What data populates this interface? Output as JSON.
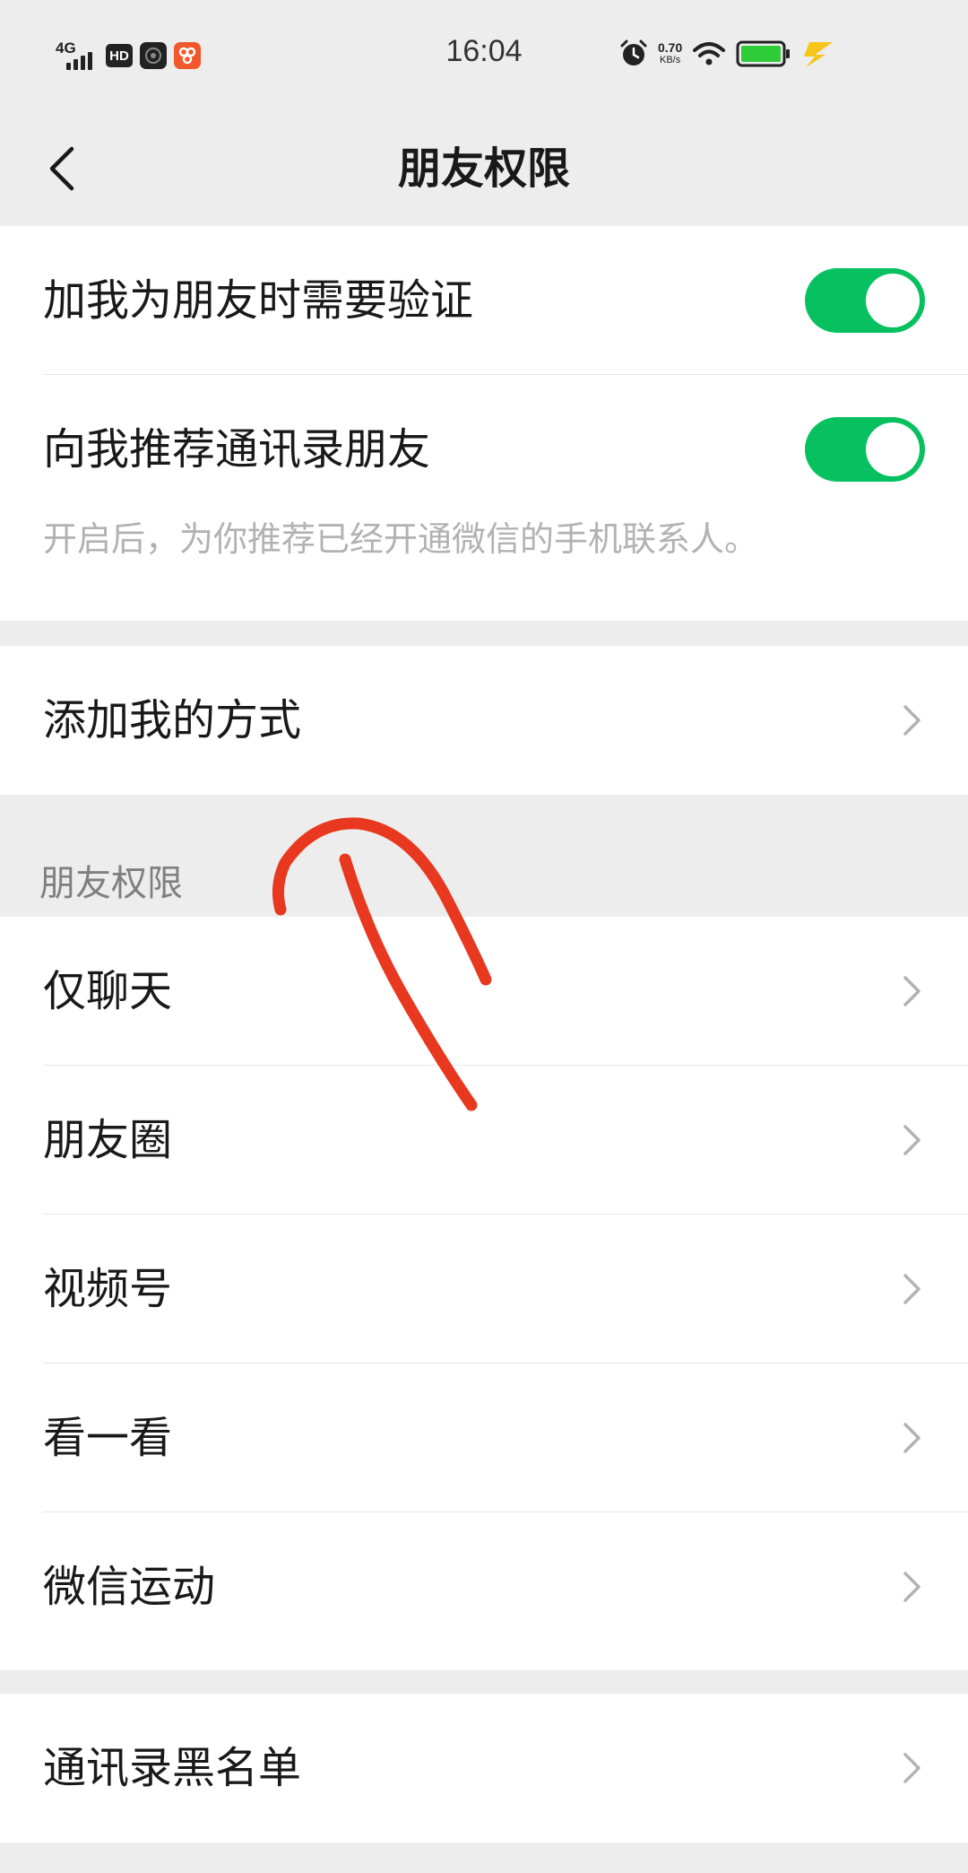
{
  "status_bar": {
    "network": "4G",
    "hd_badge": "HD",
    "time": "16:04",
    "speed_value": "0.70",
    "speed_unit": "KB/s"
  },
  "nav": {
    "title": "朋友权限"
  },
  "verification_group": {
    "require_verification": {
      "label": "加我为朋友时需要验证",
      "enabled": true
    },
    "recommend_contacts": {
      "label": "向我推荐通讯录朋友",
      "enabled": true,
      "hint": "开启后，为你推荐已经开通微信的手机联系人。"
    }
  },
  "add_methods": {
    "label": "添加我的方式"
  },
  "permissions_section": {
    "title": "朋友权限",
    "items": [
      {
        "label": "仅聊天"
      },
      {
        "label": "朋友圈"
      },
      {
        "label": "视频号"
      },
      {
        "label": "看一看"
      },
      {
        "label": "微信运动"
      }
    ]
  },
  "blacklist": {
    "label": "通讯录黑名单"
  },
  "colors": {
    "accent": "#07c160",
    "background": "#ededed",
    "annotation": "#e8381f"
  }
}
